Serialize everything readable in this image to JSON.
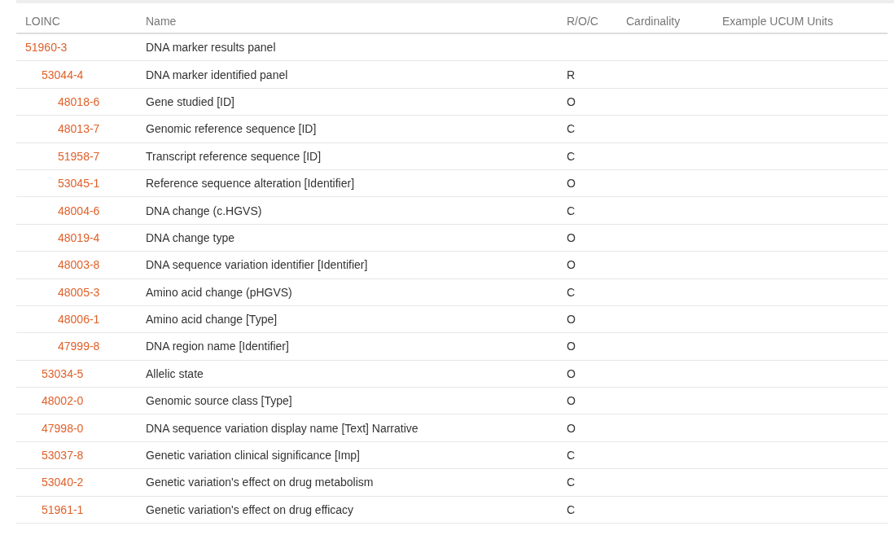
{
  "table": {
    "columns": [
      "LOINC",
      "Name",
      "R/O/C",
      "Cardinality",
      "Example UCUM Units"
    ],
    "rows": [
      {
        "loinc": "51960-3",
        "name": "DNA marker results panel",
        "children": [
          {
            "loinc": "53044-4",
            "name": "DNA marker identified panel",
            "roc": "R",
            "children": [
              {
                "loinc": "48018-6",
                "name": "Gene studied [ID]",
                "roc": "O"
              },
              {
                "loinc": "48013-7",
                "name": "Genomic reference sequence [ID]",
                "roc": "C"
              },
              {
                "loinc": "51958-7",
                "name": "Transcript reference sequence [ID]",
                "roc": "C"
              },
              {
                "loinc": "53045-1",
                "name": "Reference sequence alteration [Identifier]",
                "roc": "O"
              },
              {
                "loinc": "48004-6",
                "name": "DNA change (c.HGVS)",
                "roc": "C"
              },
              {
                "loinc": "48019-4",
                "name": "DNA change type",
                "roc": "O"
              },
              {
                "loinc": "48003-8",
                "name": "DNA sequence variation identifier [Identifier]",
                "roc": "O"
              },
              {
                "loinc": "48005-3",
                "name": "Amino acid change (pHGVS)",
                "roc": "C"
              },
              {
                "loinc": "48006-1",
                "name": "Amino acid change [Type]",
                "roc": "O"
              },
              {
                "loinc": "47999-8",
                "name": "DNA region name [Identifier]",
                "roc": "O"
              }
            ]
          },
          {
            "loinc": "53034-5",
            "name": "Allelic state",
            "roc": "O"
          },
          {
            "loinc": "48002-0",
            "name": "Genomic source class [Type]",
            "roc": "O"
          },
          {
            "loinc": "47998-0",
            "name": "DNA sequence variation display name [Text] Narrative",
            "roc": "O"
          },
          {
            "loinc": "53037-8",
            "name": "Genetic variation clinical significance [Imp]",
            "roc": "C"
          },
          {
            "loinc": "53040-2",
            "name": "Genetic variation's effect on drug metabolism",
            "roc": "C"
          },
          {
            "loinc": "51961-1",
            "name": "Genetic variation's effect on drug efficacy",
            "roc": "C"
          }
        ]
      }
    ]
  }
}
